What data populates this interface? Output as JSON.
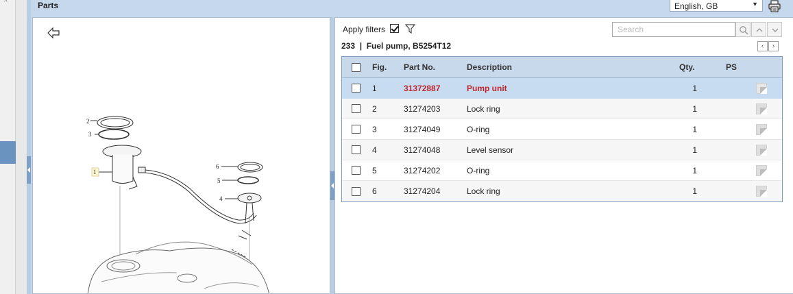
{
  "header": {
    "title": "Parts",
    "language": "English, GB"
  },
  "diagram": {
    "callouts": [
      "1",
      "2",
      "3",
      "4",
      "5",
      "6"
    ]
  },
  "toolbar": {
    "apply_filters_label": "Apply filters",
    "apply_filters_checked": true,
    "search_placeholder": "Search",
    "search_value": ""
  },
  "section": {
    "title": "233  |  Fuel pump, B5254T12"
  },
  "table": {
    "columns": {
      "fig": "Fig.",
      "part_no": "Part No.",
      "description": "Description",
      "qty": "Qty.",
      "ps": "PS"
    },
    "rows": [
      {
        "fig": "1",
        "part_no": "31372887",
        "description": "Pump unit",
        "qty": "1",
        "selected": true
      },
      {
        "fig": "2",
        "part_no": "31274203",
        "description": "Lock ring",
        "qty": "1",
        "selected": false
      },
      {
        "fig": "3",
        "part_no": "31274049",
        "description": "O-ring",
        "qty": "1",
        "selected": false
      },
      {
        "fig": "4",
        "part_no": "31274048",
        "description": "Level sensor",
        "qty": "1",
        "selected": false
      },
      {
        "fig": "5",
        "part_no": "31274202",
        "description": "O-ring",
        "qty": "1",
        "selected": false
      },
      {
        "fig": "6",
        "part_no": "31274204",
        "description": "Lock ring",
        "qty": "1",
        "selected": false
      }
    ]
  },
  "icons": {
    "back": "back-arrow-icon",
    "filter": "filter-icon",
    "search": "search-icon",
    "prev": "chevron-up-icon",
    "next": "chevron-down-icon",
    "print": "print-icon",
    "note": "note-icon"
  },
  "colors": {
    "header_bg": "#c5d8ec",
    "selected_row": "#c7dbf1",
    "selected_text": "#c0262a"
  }
}
